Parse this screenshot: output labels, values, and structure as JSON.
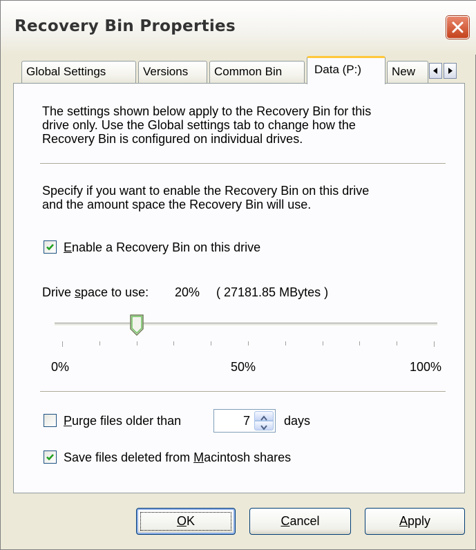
{
  "window": {
    "title": "Recovery Bin Properties"
  },
  "tabs": [
    {
      "label": "Global Settings"
    },
    {
      "label": "Versions"
    },
    {
      "label": "Common Bin"
    },
    {
      "label": "Data (P:)",
      "active": true
    },
    {
      "label": "New"
    }
  ],
  "intro": {
    "line1": "The settings shown below apply to the Recovery Bin for this",
    "line2": "drive only.  Use the Global settings tab to change how the",
    "line3": "Recovery Bin is configured on individual drives."
  },
  "spec": {
    "line1": "Specify if you want to enable the Recovery Bin on this drive",
    "line2": "and the amount space the Recovery Bin will use."
  },
  "enable": {
    "checked": true,
    "mnemonic": "E",
    "rest": "nable a Recovery Bin on this drive"
  },
  "drive_space": {
    "prefix": "Drive ",
    "mnemonic": "s",
    "suffix": "pace to use:",
    "percent_text": "20%",
    "mbytes_text": "(  27181.85 MBytes )",
    "value_percent": 20
  },
  "slider_labels": {
    "min": "0%",
    "mid": "50%",
    "max": "100%"
  },
  "purge": {
    "checked": false,
    "mnemonic": "P",
    "rest": "urge files older than",
    "value": "7",
    "unit": "days"
  },
  "mac": {
    "checked": true,
    "prefix": "Save files deleted from ",
    "mnemonic": "M",
    "rest": "acintosh shares"
  },
  "buttons": {
    "ok_mnemonic": "O",
    "ok_rest": "K",
    "cancel_mnemonic": "C",
    "cancel_rest": "ancel",
    "apply_mnemonic": "A",
    "apply_rest": "pply"
  }
}
